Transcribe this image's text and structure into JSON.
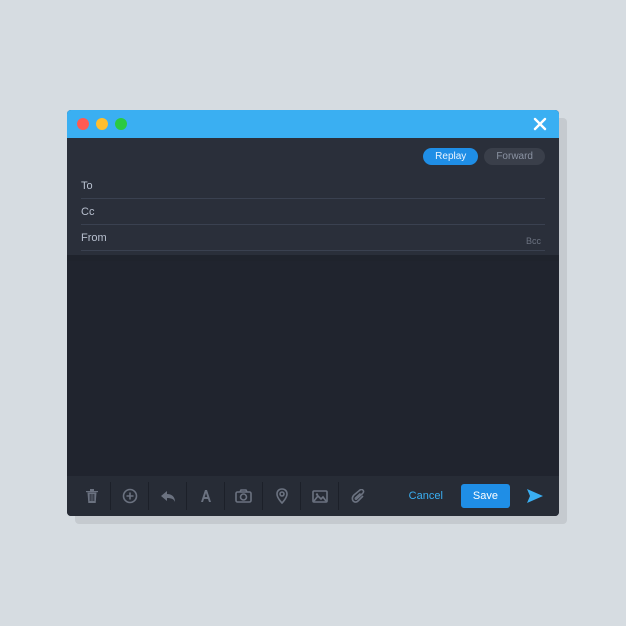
{
  "titlebar": {
    "close_label": "Close"
  },
  "actions": {
    "reply": "Replay",
    "forward": "Forward"
  },
  "fields": {
    "to_label": "To",
    "cc_label": "Cc",
    "from_label": "From",
    "bcc_label": "Bcc",
    "to_value": "",
    "cc_value": "",
    "from_value": ""
  },
  "toolbar": {
    "cancel": "Cancel",
    "save": "Save"
  },
  "colors": {
    "titlebar": "#3aaff2",
    "window_bg": "#2a2f3a",
    "body_bg": "#20242e",
    "accent": "#1f8ee6"
  }
}
